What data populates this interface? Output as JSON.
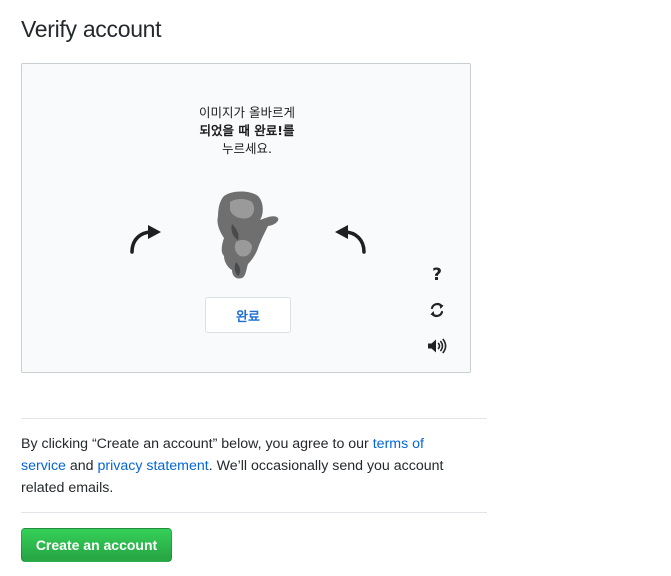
{
  "page": {
    "title": "Verify account"
  },
  "captcha": {
    "instruction_line1": "이미지가 올바르게",
    "instruction_line2": "되었을 때 완료!를",
    "instruction_line3": "누르세요.",
    "done_label": "완료",
    "help_label": "?",
    "icons": {
      "rotate_left": "rotate-left-arrow-icon",
      "rotate_right": "rotate-right-arrow-icon",
      "image": "elephant-image",
      "help": "help-icon",
      "refresh": "refresh-icon",
      "audio": "audio-icon"
    }
  },
  "terms": {
    "prefix": "By clicking “Create an account” below, you agree to our ",
    "terms_link": "terms of service",
    "middle": " and ",
    "privacy_link": "privacy statement",
    "suffix": ". We’ll occasionally send you account related emails."
  },
  "actions": {
    "create_label": "Create an account"
  },
  "colors": {
    "link": "#0366d6",
    "primary_button": "#28a745",
    "done_text": "#1f6fd1"
  }
}
